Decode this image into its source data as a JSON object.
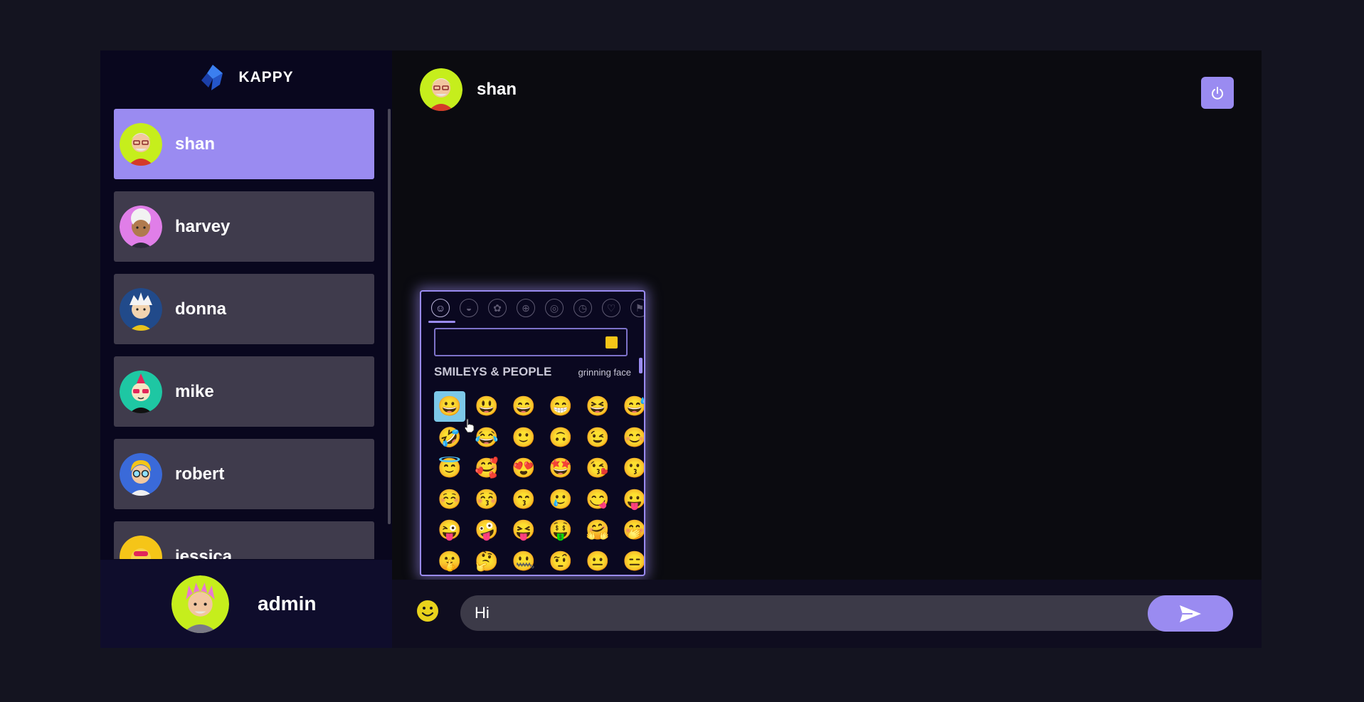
{
  "app": {
    "brand": "KAPPY"
  },
  "sidebar": {
    "contacts": [
      {
        "name": "shan",
        "active": true,
        "avatar_bg": "#c6ee1c"
      },
      {
        "name": "harvey",
        "active": false,
        "avatar_bg": "#e07ee8"
      },
      {
        "name": "donna",
        "active": false,
        "avatar_bg": "#214a8a"
      },
      {
        "name": "mike",
        "active": false,
        "avatar_bg": "#1ec7a3"
      },
      {
        "name": "robert",
        "active": false,
        "avatar_bg": "#3a6ad9"
      },
      {
        "name": "jessica",
        "active": false,
        "avatar_bg": "#f5c518"
      }
    ],
    "current_user": {
      "name": "admin",
      "avatar_bg": "#c6ee1c"
    }
  },
  "chat": {
    "header_name": "shan",
    "message_value": "Hi"
  },
  "emoji_picker": {
    "categories": [
      "people-icon",
      "food-icon",
      "nature-icon",
      "activity-icon",
      "travel-icon",
      "objects-icon",
      "symbols-icon",
      "flags-icon"
    ],
    "section_title": "SMILEYS & PEOPLE",
    "preview_name": "grinning face",
    "emojis": [
      "😀",
      "😃",
      "😄",
      "😁",
      "😆",
      "😅",
      "🤣",
      "😂",
      "🙂",
      "🙃",
      "😉",
      "😊",
      "😇",
      "🥰",
      "😍",
      "🤩",
      "😘",
      "😗",
      "☺️",
      "😚",
      "😙",
      "🥲",
      "😋",
      "😛",
      "😜",
      "🤪",
      "😝",
      "🤑",
      "🤗",
      "🤭",
      "🤫",
      "🤔",
      "🤐",
      "🤨",
      "😐",
      "😑"
    ]
  },
  "colors": {
    "accent": "#9a8bf1",
    "contact_bg": "#3f3b4c",
    "sidebar_bg": "#09071e",
    "emoji_yellow": "#f5c518"
  }
}
